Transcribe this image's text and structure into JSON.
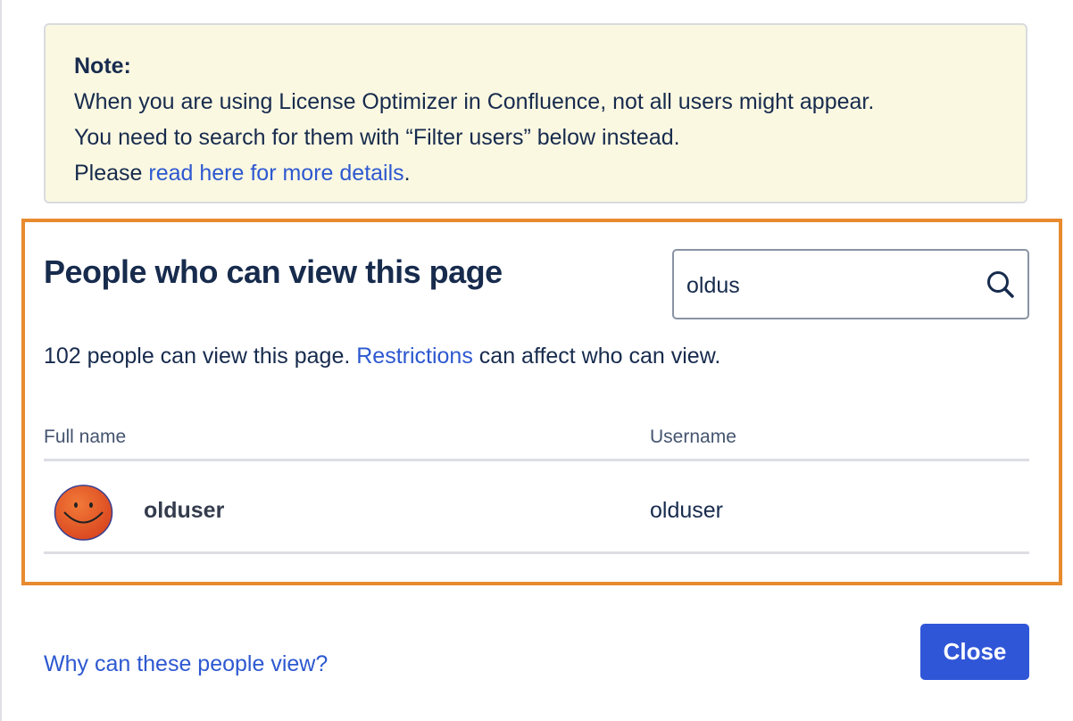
{
  "note": {
    "title": "Note:",
    "line1": "When you are using License Optimizer in Confluence, not all users might appear.",
    "line2": "You need to search for them with “Filter users” below instead.",
    "line3_prefix": "Please ",
    "line3_link": "read here for more details",
    "line3_suffix": "."
  },
  "panel": {
    "heading": "People who can view this page",
    "search": {
      "value": "oldus",
      "icon": "search-icon"
    },
    "summary_prefix": "102 people can view this page. ",
    "summary_link": "Restrictions",
    "summary_suffix": " can affect who can view.",
    "table": {
      "columns": [
        "Full name",
        "Username"
      ],
      "rows": [
        {
          "full_name": "olduser",
          "username": "olduser",
          "avatar": "smiley-avatar"
        }
      ]
    },
    "highlight_color": "#e88a2e"
  },
  "footer": {
    "why_link": "Why can these people view?",
    "close_label": "Close"
  },
  "colors": {
    "link": "#2d58d0",
    "primary_button": "#3056d8",
    "note_bg": "#fbf8e2",
    "text": "#172b4d"
  }
}
